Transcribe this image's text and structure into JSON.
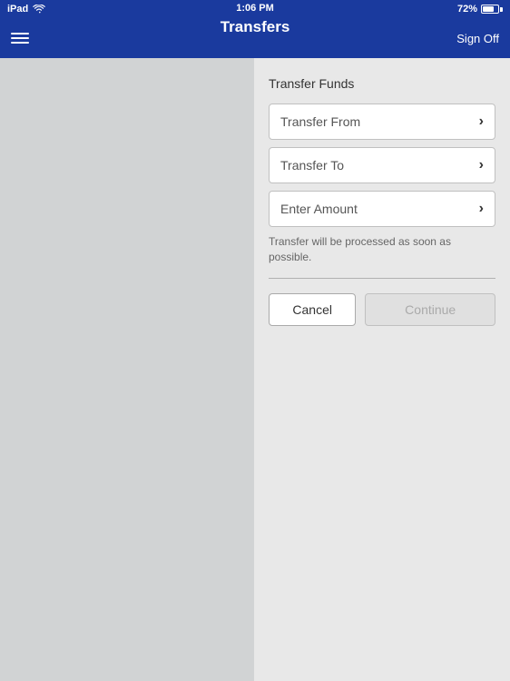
{
  "status_bar": {
    "device": "iPad",
    "time": "1:06 PM",
    "battery_percent": "72%"
  },
  "nav": {
    "title": "Transfers",
    "signoff_label": "Sign Off"
  },
  "form": {
    "section_title": "Transfer Funds",
    "field_from_label": "Transfer From",
    "field_to_label": "Transfer To",
    "field_amount_label": "Enter Amount",
    "info_text": "Transfer will be processed as soon as possible.",
    "cancel_label": "Cancel",
    "continue_label": "Continue"
  }
}
